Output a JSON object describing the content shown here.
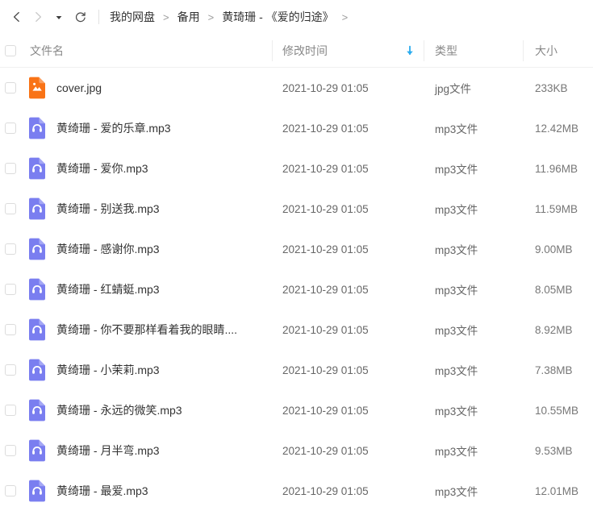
{
  "nav": {
    "back_icon": "chevron-left-icon",
    "forward_icon": "chevron-right-icon",
    "dropdown_icon": "caret-down-icon",
    "refresh_icon": "refresh-icon",
    "breadcrumb": [
      {
        "label": "我的网盘",
        "sep": ">"
      },
      {
        "label": "备用",
        "sep": ">"
      },
      {
        "label": "黄琦珊 - 《爱的归途》",
        "sep": ">"
      }
    ]
  },
  "colors": {
    "accent_blue": "#2aabee",
    "mp3_icon": "#7a7ef0",
    "jpg_icon": "#f97316",
    "text_primary": "#333333",
    "text_secondary": "#666666",
    "text_header": "#888888",
    "border": "#ededed"
  },
  "table": {
    "headers": {
      "name": "文件名",
      "time": "修改时间",
      "type": "类型",
      "size": "大小",
      "sort_icon": "arrow-down-icon",
      "sort_column": "修改时间",
      "sort_direction": "desc"
    },
    "rows": [
      {
        "name": "cover.jpg",
        "time": "2021-10-29 01:05",
        "type": "jpg文件",
        "size": "233KB",
        "icon": "image-file-icon"
      },
      {
        "name": "黄绮珊 - 爱的乐章.mp3",
        "time": "2021-10-29 01:05",
        "type": "mp3文件",
        "size": "12.42MB",
        "icon": "audio-file-icon"
      },
      {
        "name": "黄绮珊 - 爱你.mp3",
        "time": "2021-10-29 01:05",
        "type": "mp3文件",
        "size": "11.96MB",
        "icon": "audio-file-icon"
      },
      {
        "name": "黄绮珊 - 别送我.mp3",
        "time": "2021-10-29 01:05",
        "type": "mp3文件",
        "size": "11.59MB",
        "icon": "audio-file-icon"
      },
      {
        "name": "黄绮珊 - 感谢你.mp3",
        "time": "2021-10-29 01:05",
        "type": "mp3文件",
        "size": "9.00MB",
        "icon": "audio-file-icon"
      },
      {
        "name": "黄绮珊 - 红蜻蜓.mp3",
        "time": "2021-10-29 01:05",
        "type": "mp3文件",
        "size": "8.05MB",
        "icon": "audio-file-icon"
      },
      {
        "name": "黄绮珊 - 你不要那样看着我的眼睛....",
        "time": "2021-10-29 01:05",
        "type": "mp3文件",
        "size": "8.92MB",
        "icon": "audio-file-icon"
      },
      {
        "name": "黄绮珊 - 小茉莉.mp3",
        "time": "2021-10-29 01:05",
        "type": "mp3文件",
        "size": "7.38MB",
        "icon": "audio-file-icon"
      },
      {
        "name": "黄绮珊 - 永远的微笑.mp3",
        "time": "2021-10-29 01:05",
        "type": "mp3文件",
        "size": "10.55MB",
        "icon": "audio-file-icon"
      },
      {
        "name": "黄绮珊 - 月半弯.mp3",
        "time": "2021-10-29 01:05",
        "type": "mp3文件",
        "size": "9.53MB",
        "icon": "audio-file-icon"
      },
      {
        "name": "黄绮珊 - 最爱.mp3",
        "time": "2021-10-29 01:05",
        "type": "mp3文件",
        "size": "12.01MB",
        "icon": "audio-file-icon"
      }
    ]
  }
}
